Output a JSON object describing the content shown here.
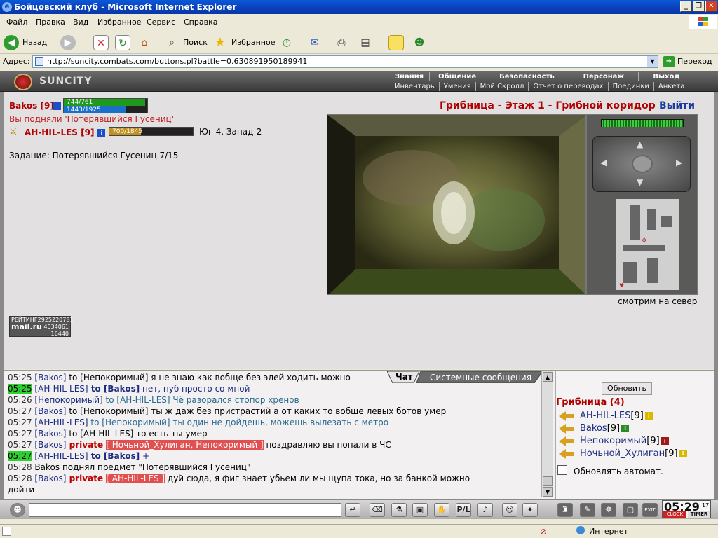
{
  "window": {
    "title": "Бойцовский клуб - Microsoft Internet Explorer"
  },
  "menu": [
    "Файл",
    "Правка",
    "Вид",
    "Избранное",
    "Сервис",
    "Справка"
  ],
  "toolbar": {
    "back": "Назад",
    "search": "Поиск",
    "favorites": "Избранное"
  },
  "address": {
    "label": "Адрес:",
    "url": "http://suncity.combats.com/buttons.pl?battle=0.630891950189941",
    "go": "Переход"
  },
  "game": {
    "logo": "SUNCITY",
    "nav_top": [
      "Знания",
      "Общение",
      "Безопасность",
      "Персонаж",
      "Выход"
    ],
    "nav_bottom": [
      "Инвентарь",
      "Умения",
      "Мой Скролл",
      "Отчет о переводах",
      "Поединки",
      "Анкета"
    ],
    "player": {
      "name": "Bakos",
      "level": "[9]",
      "hp": "744/761",
      "mana": "1443/1925",
      "hp_fraction": 0.978,
      "mana_fraction": 0.75
    },
    "picked_message": "Вы подняли 'Потерявшийся Гусениц'",
    "partner": {
      "name": "AH-HIL-LES",
      "level": "[9]",
      "hp": "700/1845",
      "hp_fraction": 0.38,
      "coords": "Юг-4, Запад-2"
    },
    "task": "Задание: Потерявшийся Гусениц 7/15",
    "location": "Грибница - Этаж 1 - Грибной коридор",
    "exit": "Выйти",
    "facing": "смотрим на север",
    "rating": {
      "label": "РЕЙТИНГ",
      "num1": "2925220781",
      "brand": "mail.ru",
      "num2": "4034061",
      "num3": "16440"
    }
  },
  "chat": {
    "tabs": {
      "chat": "Чат",
      "system": "Системные сообщения"
    },
    "lines": [
      {
        "time": "05:25",
        "hl": false,
        "parts": [
          {
            "c": "nm",
            "t": "[Bakos]"
          },
          {
            "c": "",
            "t": " to [Непокоримый] я не знаю как вобще без элей ходить можно"
          }
        ]
      },
      {
        "time": "05:25",
        "hl": true,
        "parts": [
          {
            "c": "nm",
            "t": "[AH-HIL-LES]"
          },
          {
            "c": "to",
            "t": " to [Bakos]"
          },
          {
            "c": "nm",
            "t": " нет, нуб просто со мной"
          }
        ]
      },
      {
        "time": "05:26",
        "hl": false,
        "parts": [
          {
            "c": "nm",
            "t": "[Непокоримый]"
          },
          {
            "c": "toc",
            "t": " to [AH-HIL-LES] Чё разорался стопор хренов"
          }
        ]
      },
      {
        "time": "05:27",
        "hl": false,
        "parts": [
          {
            "c": "nm",
            "t": "[Bakos]"
          },
          {
            "c": "",
            "t": " to [Непокоримый] ты ж даж без пристрастий а от каких то вобще левых ботов умер"
          }
        ]
      },
      {
        "time": "05:27",
        "hl": false,
        "parts": [
          {
            "c": "nm",
            "t": "[AH-HIL-LES]"
          },
          {
            "c": "toc",
            "t": " to [Непокоримый] ты один не дойдешь, можешь вылезать с метро"
          }
        ]
      },
      {
        "time": "05:27",
        "hl": false,
        "parts": [
          {
            "c": "nm",
            "t": "[Bakos]"
          },
          {
            "c": "",
            "t": " to [AH-HIL-LES] то есть ты умер"
          }
        ]
      },
      {
        "time": "05:27",
        "hl": false,
        "parts": [
          {
            "c": "nm",
            "t": "[Bakos]"
          },
          {
            "c": "pr",
            "t": " private "
          },
          {
            "c": "prn",
            "t": "[ Ночьной_Хулиган, Непокоримый ]"
          },
          {
            "c": "",
            "t": " поздравляю вы попали в ЧС"
          }
        ]
      },
      {
        "time": "05:27",
        "hl": true,
        "parts": [
          {
            "c": "nm",
            "t": "[AH-HIL-LES]"
          },
          {
            "c": "to",
            "t": " to [Bakos]"
          },
          {
            "c": "nm",
            "t": " +"
          }
        ]
      },
      {
        "time": "05:28",
        "hl": false,
        "parts": [
          {
            "c": "",
            "t": "Bakos поднял предмет \"Потерявшийся Гусениц\""
          }
        ]
      },
      {
        "time": "05:28",
        "hl": false,
        "parts": [
          {
            "c": "nm",
            "t": "[Bakos]"
          },
          {
            "c": "pr",
            "t": " private "
          },
          {
            "c": "prn",
            "t": "[ AH-HIL-LES ]"
          },
          {
            "c": "",
            "t": " дуй сюда, я фиг знает убьем ли мы щупа тока, но за банкой можно"
          }
        ]
      }
    ],
    "wrap_line": "дойти"
  },
  "room": {
    "refresh": "Обновить",
    "title": "Грибница (4)",
    "players": [
      {
        "name": "AH-HIL-LES",
        "level": "[9]",
        "badge": "i",
        "color": "#d8b800"
      },
      {
        "name": "Bakos",
        "level": "[9]",
        "badge": "i",
        "color": "#2a8a2a"
      },
      {
        "name": "Непокоримый",
        "level": "[9]",
        "badge": "i",
        "color": "#a01818"
      },
      {
        "name": "Ночьной_Хулиган",
        "level": "[9]",
        "badge": "i",
        "color": "#d8b800"
      }
    ],
    "auto": "Обновлять автомат."
  },
  "clock": {
    "time": "05:29",
    "sec": "17",
    "label1": "CLOCK",
    "label2": "TIMER"
  },
  "status": {
    "zone": "Интернет"
  }
}
